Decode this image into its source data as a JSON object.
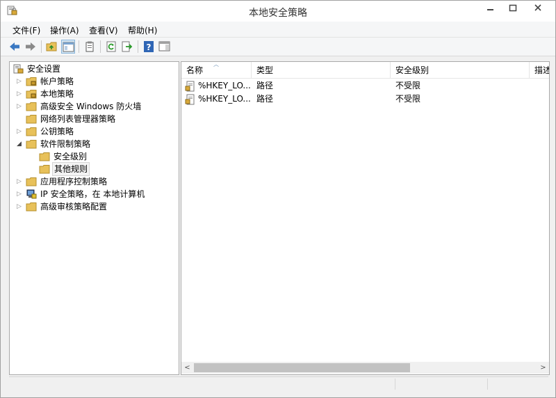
{
  "window": {
    "title": "本地安全策略"
  },
  "menu": [
    {
      "label": "文件(F)"
    },
    {
      "label": "操作(A)"
    },
    {
      "label": "查看(V)"
    },
    {
      "label": "帮助(H)"
    }
  ],
  "tree": {
    "root": "安全设置",
    "items": [
      {
        "label": "帐户策略"
      },
      {
        "label": "本地策略"
      },
      {
        "label": "高级安全 Windows 防火墙"
      },
      {
        "label": "网络列表管理器策略"
      },
      {
        "label": "公钥策略"
      },
      {
        "label": "软件限制策略"
      },
      {
        "label": "安全级别"
      },
      {
        "label": "其他规则"
      },
      {
        "label": "应用程序控制策略"
      },
      {
        "label": "IP 安全策略，在 本地计算机"
      },
      {
        "label": "高级审核策略配置"
      }
    ]
  },
  "list": {
    "columns": [
      "名称",
      "类型",
      "安全级别",
      "描述"
    ],
    "rows": [
      {
        "name": "%HKEY_LO...",
        "type": "路径",
        "level": "不受限"
      },
      {
        "name": "%HKEY_LO...",
        "type": "路径",
        "level": "不受限"
      }
    ]
  },
  "colors": {
    "accent": "#3a78c2",
    "folder": "#e8c15a"
  }
}
